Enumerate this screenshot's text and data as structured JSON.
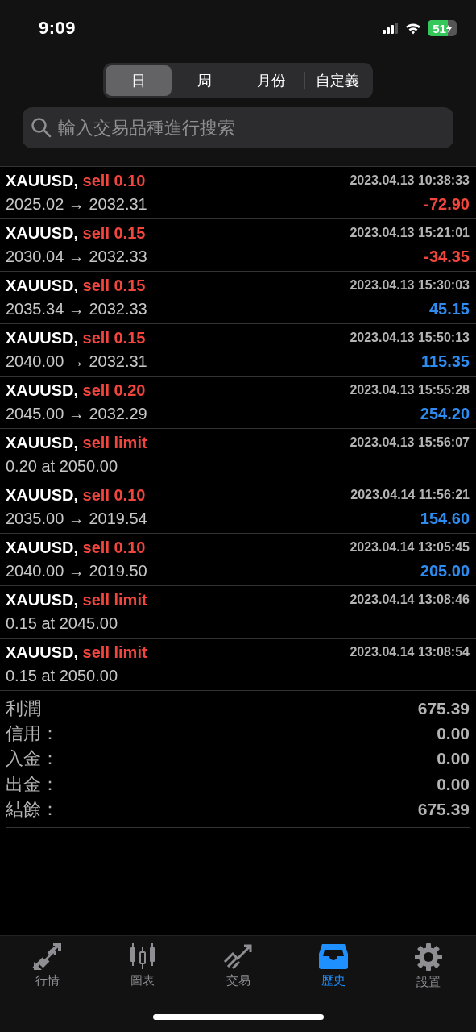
{
  "status_bar": {
    "time": "9:09",
    "battery": "51"
  },
  "period_tabs": [
    {
      "label": "日",
      "selected": true
    },
    {
      "label": "周",
      "selected": false
    },
    {
      "label": "月份",
      "selected": false
    },
    {
      "label": "自定義",
      "selected": false
    }
  ],
  "search": {
    "placeholder": "輸入交易品種進行搜索"
  },
  "orders": [
    {
      "kind": "closed",
      "symbol": "XAUUSD,",
      "type": "sell 0.10",
      "time": "2023.04.13 10:38:33",
      "detail": "2025.02 → 2032.31",
      "profit": "-72.90",
      "color": "#f2453d"
    },
    {
      "kind": "closed",
      "symbol": "XAUUSD,",
      "type": "sell 0.15",
      "time": "2023.04.13 15:21:01",
      "detail": "2030.04 → 2032.33",
      "profit": "-34.35",
      "color": "#f2453d"
    },
    {
      "kind": "closed",
      "symbol": "XAUUSD,",
      "type": "sell 0.15",
      "time": "2023.04.13 15:30:03",
      "detail": "2035.34 → 2032.33",
      "profit": "45.15",
      "color": "#2e8cf0"
    },
    {
      "kind": "closed",
      "symbol": "XAUUSD,",
      "type": "sell 0.15",
      "time": "2023.04.13 15:50:13",
      "detail": "2040.00 → 2032.31",
      "profit": "115.35",
      "color": "#2e8cf0"
    },
    {
      "kind": "closed",
      "symbol": "XAUUSD,",
      "type": "sell 0.20",
      "time": "2023.04.13 15:55:28",
      "detail": "2045.00 → 2032.29",
      "profit": "254.20",
      "color": "#2e8cf0"
    },
    {
      "kind": "pending",
      "symbol": "XAUUSD,",
      "type": "sell limit",
      "time": "2023.04.13 15:56:07",
      "detail": "0.20 at 2050.00"
    },
    {
      "kind": "closed",
      "symbol": "XAUUSD,",
      "type": "sell 0.10",
      "time": "2023.04.14 11:56:21",
      "detail": "2035.00 → 2019.54",
      "profit": "154.60",
      "color": "#2e8cf0"
    },
    {
      "kind": "closed",
      "symbol": "XAUUSD,",
      "type": "sell 0.10",
      "time": "2023.04.14 13:05:45",
      "detail": "2040.00 → 2019.50",
      "profit": "205.00",
      "color": "#2e8cf0"
    },
    {
      "kind": "pending",
      "symbol": "XAUUSD,",
      "type": "sell limit",
      "time": "2023.04.14 13:08:46",
      "detail": "0.15 at 2045.00"
    },
    {
      "kind": "pending",
      "symbol": "XAUUSD,",
      "type": "sell limit",
      "time": "2023.04.14 13:08:54",
      "detail": "0.15 at 2050.00"
    }
  ],
  "summary": [
    {
      "label": "利潤",
      "value": "675.39"
    },
    {
      "label": "信用：",
      "value": "0.00"
    },
    {
      "label": "入金：",
      "value": "0.00"
    },
    {
      "label": "出金：",
      "value": "0.00"
    },
    {
      "label": "結餘：",
      "value": "675.39"
    }
  ],
  "tab_bar": [
    {
      "label": "行情",
      "selected": false
    },
    {
      "label": "圖表",
      "selected": false
    },
    {
      "label": "交易",
      "selected": false
    },
    {
      "label": "歷史",
      "selected": true
    },
    {
      "label": "設置",
      "selected": false
    }
  ]
}
